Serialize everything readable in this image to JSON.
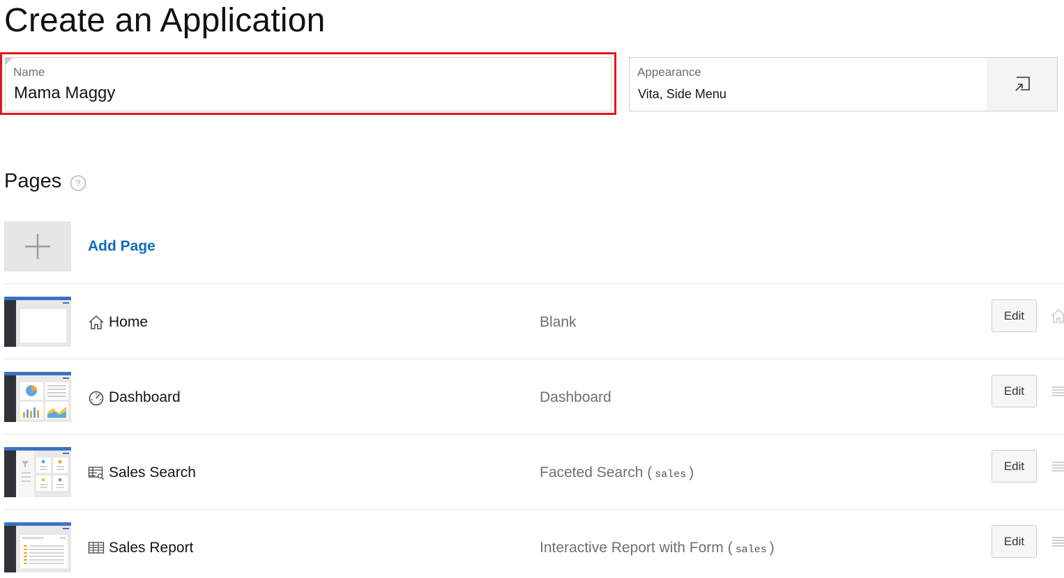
{
  "title": "Create an Application",
  "name_field": {
    "label": "Name",
    "value": "Mama Maggy"
  },
  "appearance": {
    "label": "Appearance",
    "value": "Vita, Side Menu",
    "button_icon": "open-dialog-icon"
  },
  "pages_section": {
    "title": "Pages",
    "help_icon": "help-icon"
  },
  "add_page": {
    "label": "Add Page",
    "icon": "plus-icon"
  },
  "pages": [
    {
      "name": "Home",
      "icon": "home-icon",
      "type": "Blank",
      "source": "",
      "edit_label": "Edit",
      "row_icon": "home-icon"
    },
    {
      "name": "Dashboard",
      "icon": "dashboard-icon",
      "type": "Dashboard",
      "source": "",
      "edit_label": "Edit",
      "row_icon": "drag-handle-icon"
    },
    {
      "name": "Sales Search",
      "icon": "faceted-search-icon",
      "type": "Faceted Search",
      "source": "sales",
      "edit_label": "Edit",
      "row_icon": "drag-handle-icon"
    },
    {
      "name": "Sales Report",
      "icon": "report-icon",
      "type": "Interactive Report with Form",
      "source": "sales",
      "edit_label": "Edit",
      "row_icon": "drag-handle-icon"
    }
  ],
  "colors": {
    "highlight": "#e0161f",
    "link": "#0f6cbd",
    "thumb_header": "#3a72c4",
    "thumb_sidebar": "#2f3237"
  }
}
